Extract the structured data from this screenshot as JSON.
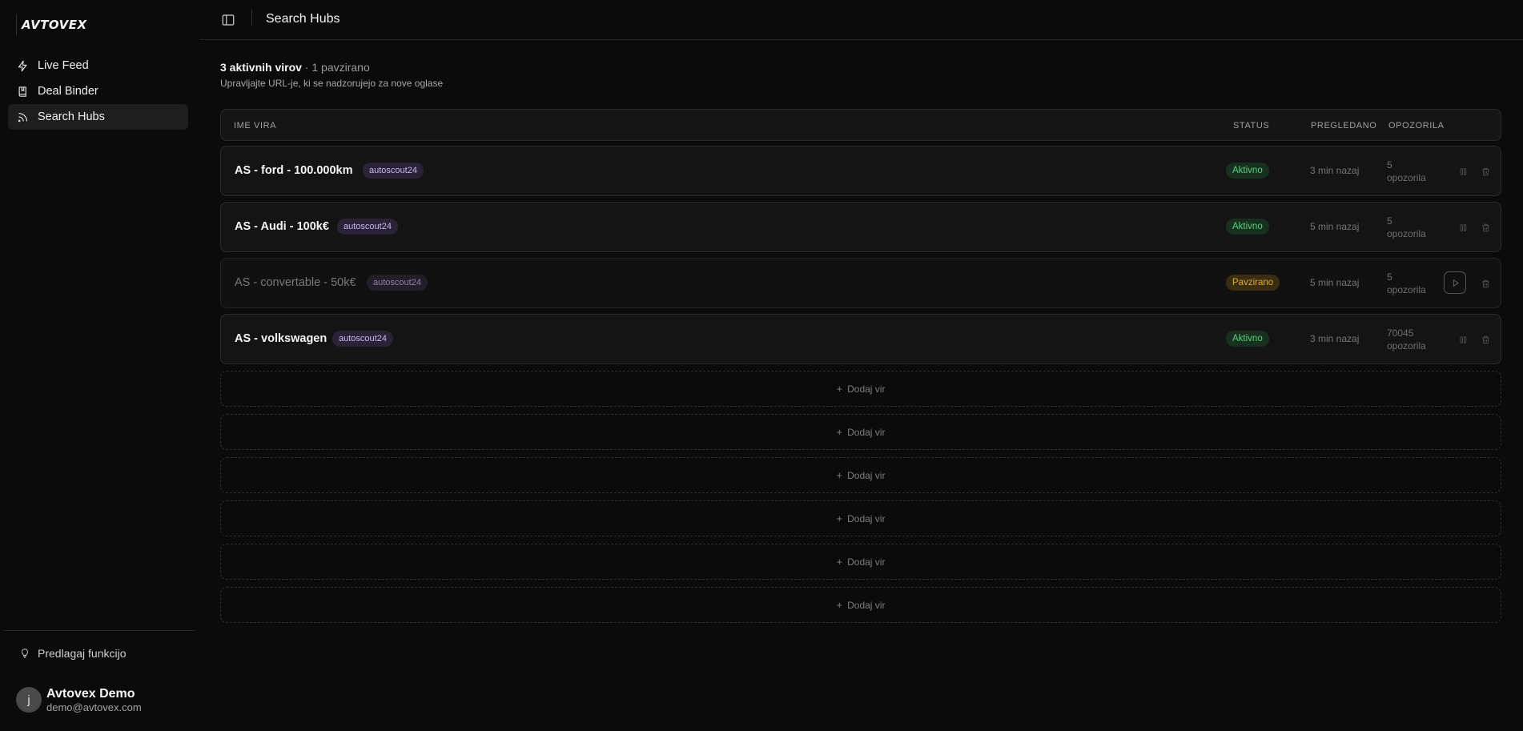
{
  "app": {
    "logo": "AVTOVEX"
  },
  "sidebar": {
    "items": [
      {
        "label": "Live Feed",
        "icon": "zap-icon"
      },
      {
        "label": "Deal Binder",
        "icon": "book-icon"
      },
      {
        "label": "Search Hubs",
        "icon": "rss-icon",
        "active": true
      }
    ],
    "suggest_label": "Predlagaj funkcijo",
    "user": {
      "initial": "j",
      "name": "Avtovex Demo",
      "email": "demo@avtovex.com"
    }
  },
  "header": {
    "title": "Search Hubs"
  },
  "summary": {
    "active_text": "3 aktivnih virov",
    "paused_text": " · 1 pavzirano",
    "subtitle": "Upravljajte URL-je, ki se nadzorujejo za nove oglase"
  },
  "table": {
    "headers": {
      "name": "IME VIRA",
      "status": "STATUS",
      "reviewed": "PREGLEDANO",
      "alerts": "OPOZORILA"
    },
    "rows": [
      {
        "name": "AS - ford - 100.000km",
        "tag": "autoscout24",
        "status": "Aktivno",
        "reviewed": "3 min nazaj",
        "alerts_count": "5",
        "alerts_label": "opozorila"
      },
      {
        "name": "AS - Audi - 100k€",
        "tag": "autoscout24",
        "status": "Aktivno",
        "reviewed": "5 min nazaj",
        "alerts_count": "5",
        "alerts_label": "opozorila"
      },
      {
        "name": "AS - convertable - 50k€",
        "tag": "autoscout24",
        "status": "Pavzirano",
        "reviewed": "5 min nazaj",
        "alerts_count": "5",
        "alerts_label": "opozorila"
      },
      {
        "name": "AS - volkswagen",
        "tag": "autoscout24",
        "status": "Aktivno",
        "reviewed": "3 min nazaj",
        "alerts_count": "70045",
        "alerts_label": "opozorila"
      }
    ],
    "add_label": "Dodaj vir"
  },
  "colors": {
    "active": "#58d27a",
    "paused": "#e0a838",
    "tag": "#c7b6f0"
  }
}
